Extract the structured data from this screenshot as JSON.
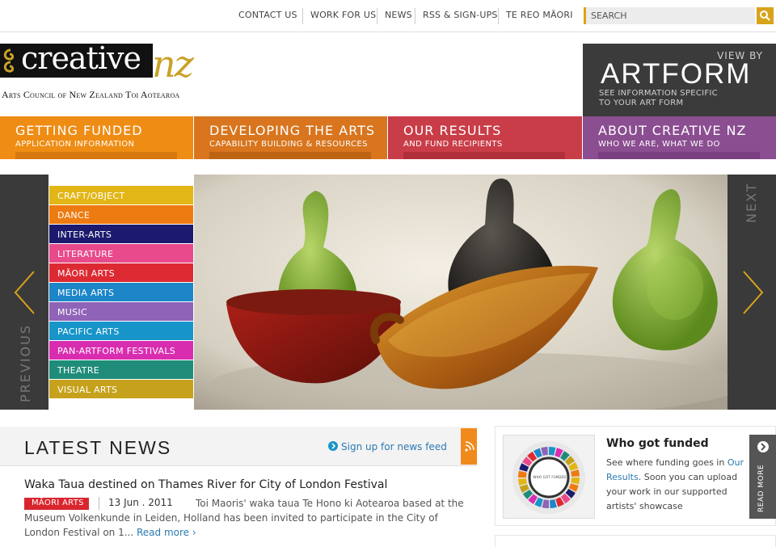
{
  "top_nav": [
    "CONTACT US",
    "WORK FOR US",
    "NEWS",
    "RSS & SIGN-UPS",
    "TE REO MĀORI"
  ],
  "search": {
    "placeholder": "SEARCH"
  },
  "logo": {
    "word": "creative",
    "nz": "nz",
    "tagline": "Arts Council of New Zealand Toi Aotearoa"
  },
  "artform": {
    "view_by": "VIEW BY",
    "title": "ARTFORM",
    "sub1": "SEE INFORMATION SPECIFIC",
    "sub2": "TO YOUR ART FORM"
  },
  "main_nav": [
    {
      "title": "GETTING FUNDED",
      "sub": "APPLICATION INFORMATION",
      "color": "#ef8c14"
    },
    {
      "title": "DEVELOPING THE ARTS",
      "sub": "CAPABILITY BUILDING & RESOURCES",
      "color": "#d8751e"
    },
    {
      "title": "OUR RESULTS",
      "sub": "AND FUND RECIPIENTS",
      "color": "#c93d48"
    },
    {
      "title": "ABOUT CREATIVE NZ",
      "sub": "WHO WE ARE, WHAT WE DO",
      "color": "#8b4e91"
    }
  ],
  "carousel": {
    "previous": "PREVIOUS",
    "next": "NEXT"
  },
  "art_forms": [
    {
      "label": "CRAFT/OBJECT",
      "color": "#e2b616"
    },
    {
      "label": "DANCE",
      "color": "#ee7b12"
    },
    {
      "label": "INTER-ARTS",
      "color": "#1b1a6e"
    },
    {
      "label": "LITERATURE",
      "color": "#e84a8c"
    },
    {
      "label": "MĀORI ARTS",
      "color": "#dd2a32"
    },
    {
      "label": "MEDIA ARTS",
      "color": "#1d86c8"
    },
    {
      "label": "MUSIC",
      "color": "#8f63b8"
    },
    {
      "label": "PACIFIC ARTS",
      "color": "#1795c9"
    },
    {
      "label": "PAN-ARTFORM FESTIVALS",
      "color": "#d92db0"
    },
    {
      "label": "THEATRE",
      "color": "#1f8c79"
    },
    {
      "label": "VISUAL ARTS",
      "color": "#c6a21c"
    }
  ],
  "news": {
    "heading": "LATEST NEWS",
    "signup": "Sign up for news feed",
    "headline": "Waka Taua destined on Thames River for City of London Festival",
    "badge": "MĀORI ARTS",
    "date": "13 Jun . 2011",
    "excerpt": "Toi Maoris' waka taua Te Hono ki Aotearoa based at the Museum Volkenkunde in Leiden, Holland has been invited to participate in the City of London Festival on 1...",
    "read_more": "Read more ›"
  },
  "who": {
    "title": "Who got funded",
    "text1": "See where funding goes in ",
    "link": "Our Results",
    "text2": ". Soon you can upload your work in our supported artists' showcase",
    "img_label": "WHO GOT FUNDED",
    "read_more": "READ MORE"
  }
}
